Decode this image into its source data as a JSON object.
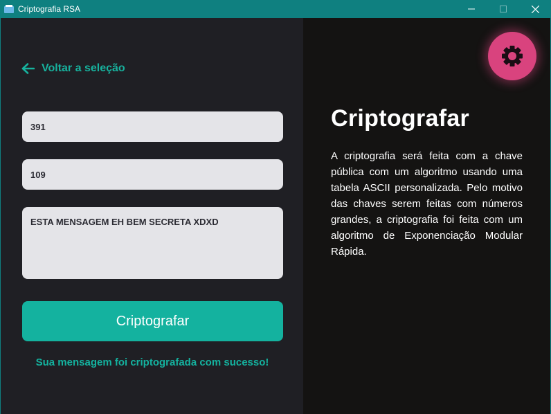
{
  "window": {
    "title": "Criptografia RSA",
    "controls": {
      "minimize": "—",
      "maximize": "☐",
      "close": "✕"
    }
  },
  "left": {
    "back_label": "Voltar a seleção",
    "fields": {
      "n_value": "391",
      "e_value": "109",
      "message": "ESTA MENSAGEM EH BEM SECRETA XDXD"
    },
    "button_label": "Criptografar",
    "status": "Sua mensagem foi criptografada com sucesso!"
  },
  "right": {
    "title": "Criptografar",
    "description": "A criptografia será feita com a chave pública com um algoritmo usando uma tabela ASCII personalizada. Pelo motivo das chaves serem feitas com números grandes, a criptografia foi feita com um algoritmo de Exponenciação Modular Rápida."
  },
  "icons": {
    "app": "app-window-icon",
    "back": "arrow-left-icon",
    "settings": "gear-icon"
  },
  "colors": {
    "accent": "#14b29f",
    "titlebar": "#0f8080",
    "settings_button": "#d9437e",
    "left_bg": "#1f1f24",
    "right_bg": "#141312"
  }
}
